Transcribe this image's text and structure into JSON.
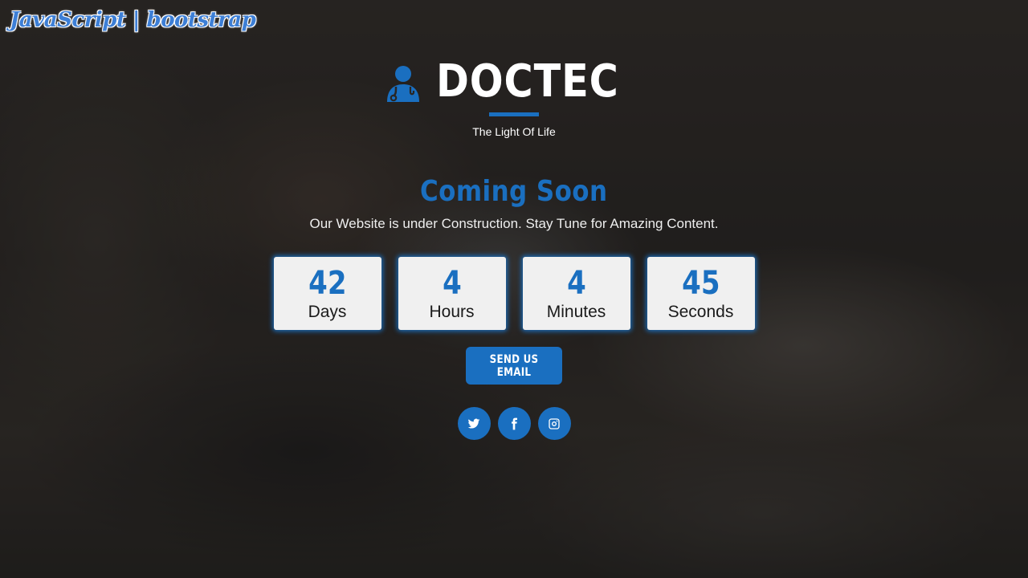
{
  "watermark": "JavaScript | bootstrap",
  "brand": {
    "icon": "doctor-icon",
    "name": "DOCTEC",
    "tagline": "The Light Of Life"
  },
  "headline": "Coming Soon",
  "subline": "Our Website is under Construction. Stay Tune for Amazing Content.",
  "countdown": [
    {
      "value": "42",
      "label": "Days"
    },
    {
      "value": "4",
      "label": "Hours"
    },
    {
      "value": "4",
      "label": "Minutes"
    },
    {
      "value": "45",
      "label": "Seconds"
    }
  ],
  "email_button": "SEND US EMAIL",
  "socials": [
    "twitter-icon",
    "facebook-icon",
    "instagram-icon"
  ],
  "colors": {
    "accent": "#1a6fc0",
    "card": "#f0f0f0"
  }
}
